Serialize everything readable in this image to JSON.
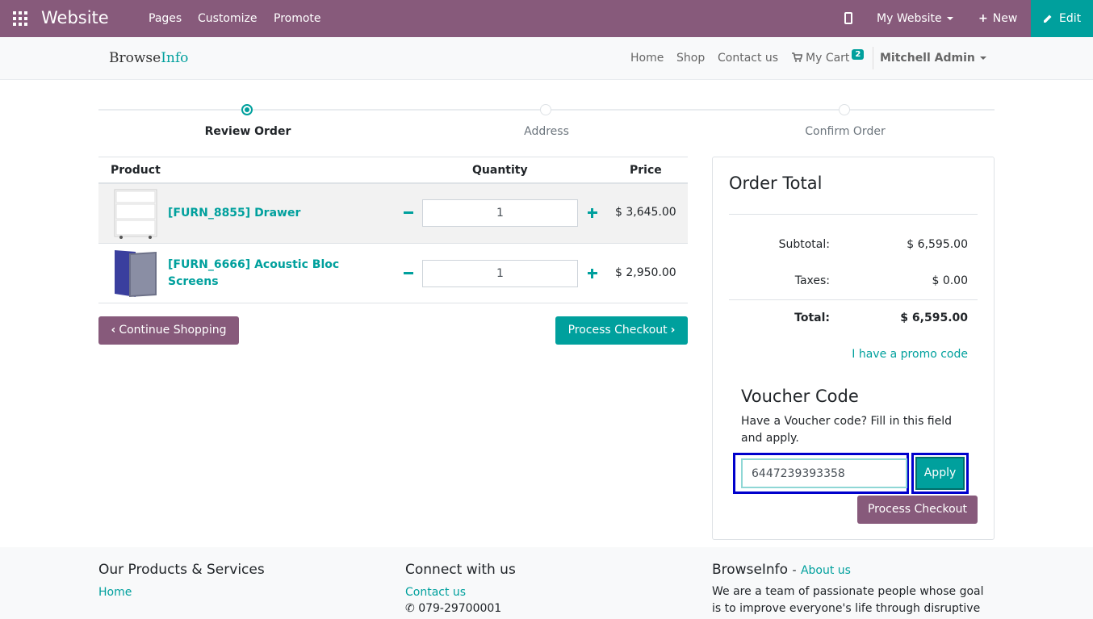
{
  "admin_bar": {
    "title": "Website",
    "menu": [
      "Pages",
      "Customize",
      "Promote"
    ],
    "site_selector": "My Website",
    "new_label": "New",
    "edit_label": "Edit",
    "colors": {
      "bar": "#875a7b",
      "edit": "#00a09d"
    }
  },
  "site_nav": {
    "logo_main": "Browse",
    "logo_accent": "Info",
    "links": [
      "Home",
      "Shop",
      "Contact us"
    ],
    "cart_label": "My Cart",
    "cart_count": "2",
    "user": "Mitchell Admin"
  },
  "steps": [
    {
      "label": "Review Order",
      "active": true
    },
    {
      "label": "Address",
      "active": false
    },
    {
      "label": "Confirm Order",
      "active": false
    }
  ],
  "cart": {
    "headers": {
      "product": "Product",
      "quantity": "Quantity",
      "price": "Price"
    },
    "rows": [
      {
        "name": "[FURN_8855] Drawer",
        "qty": "1",
        "price": "$ 3,645.00",
        "image": "drawer-image"
      },
      {
        "name": "[FURN_6666] Acoustic Bloc Screens",
        "qty": "1",
        "price": "$ 2,950.00",
        "image": "acoustic-screens-image"
      }
    ],
    "continue_label": "Continue Shopping",
    "checkout_label": "Process Checkout"
  },
  "order_total": {
    "title": "Order Total",
    "subtotal_label": "Subtotal:",
    "subtotal": "$ 6,595.00",
    "taxes_label": "Taxes:",
    "taxes": "$ 0.00",
    "total_label": "Total:",
    "total": "$ 6,595.00",
    "promo_link": "I have a promo code",
    "voucher_title": "Voucher Code",
    "voucher_help": "Have a Voucher code? Fill in this field and apply.",
    "voucher_value": "6447239393358",
    "apply_label": "Apply",
    "checkout_label": "Process Checkout"
  },
  "footer": {
    "col1_title": "Our Products & Services",
    "col1_link": "Home",
    "col2_title": "Connect with us",
    "col2_link": "Contact us",
    "col2_phone": "079-29700001",
    "col3_title": "BrowseInfo",
    "col3_sep": "-",
    "col3_link": "About us",
    "col3_text": "We are a team of passionate people whose goal is to improve everyone's life through disruptive"
  }
}
